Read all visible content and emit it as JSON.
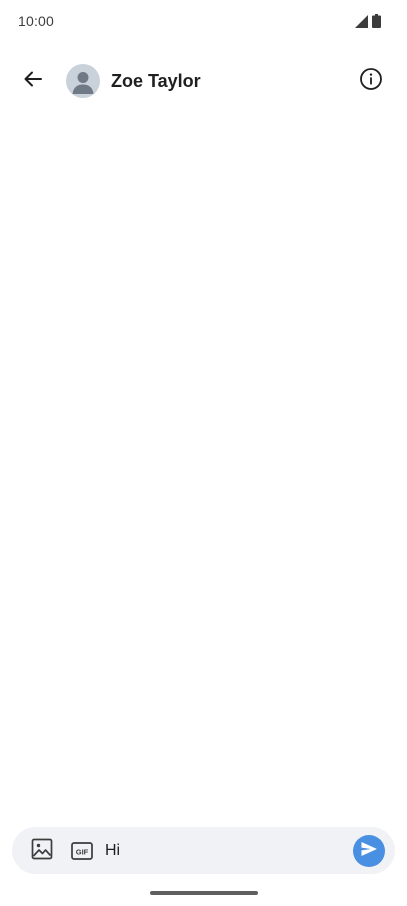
{
  "status_bar": {
    "time": "10:00",
    "icons": [
      "signal-icon",
      "battery-icon"
    ]
  },
  "header": {
    "back_icon": "arrow-back-icon",
    "avatar_icon": "person-avatar-icon",
    "contact_name": "Zoe Taylor",
    "info_icon": "info-icon"
  },
  "compose": {
    "image_icon": "image-icon",
    "gif_label": "GIF",
    "message_value": "Hi",
    "send_icon": "send-icon"
  },
  "colors": {
    "send_button": "#4a90e2",
    "compose_background": "#f1f2f6",
    "avatar_background": "#c9d1db"
  }
}
